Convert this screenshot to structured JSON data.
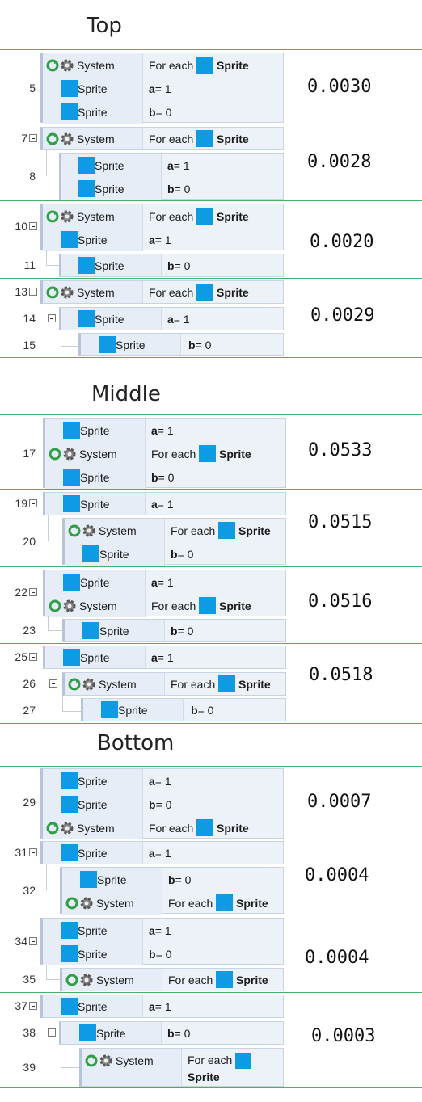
{
  "sections": {
    "top": "Top",
    "middle": "Middle",
    "bottom": "Bottom"
  },
  "labels": {
    "system": "System",
    "sprite": "Sprite",
    "for_each": "For each",
    "a": "a",
    "b": "b",
    "eq1": " = 1",
    "eq0": " = 0"
  },
  "line_numbers": {
    "n5": "5",
    "n7": "7",
    "n8": "8",
    "n10": "10",
    "n11": "11",
    "n13": "13",
    "n14": "14",
    "n15": "15",
    "n17": "17",
    "n19": "19",
    "n20": "20",
    "n22": "22",
    "n23": "23",
    "n25": "25",
    "n26": "26",
    "n27": "27",
    "n29": "29",
    "n31": "31",
    "n32": "32",
    "n34": "34",
    "n35": "35",
    "n37": "37",
    "n38": "38",
    "n39": "39"
  },
  "timings": {
    "t1": "0.0030",
    "t2": "0.0028",
    "t3": "0.0020",
    "t4": "0.0029",
    "m1": "0.0533",
    "m2": "0.0515",
    "m3": "0.0516",
    "m4": "0.0518",
    "b1": "0.0007",
    "b2": "0.0004",
    "b3": "0.0004",
    "b4": "0.0003"
  },
  "colors": {
    "sprite_icon": "#0e9be3",
    "separator": "#4caf68",
    "block_bg": "#edf2f9"
  },
  "icons": [
    "loop-icon",
    "gear-icon",
    "sprite-icon",
    "collapse-icon"
  ]
}
